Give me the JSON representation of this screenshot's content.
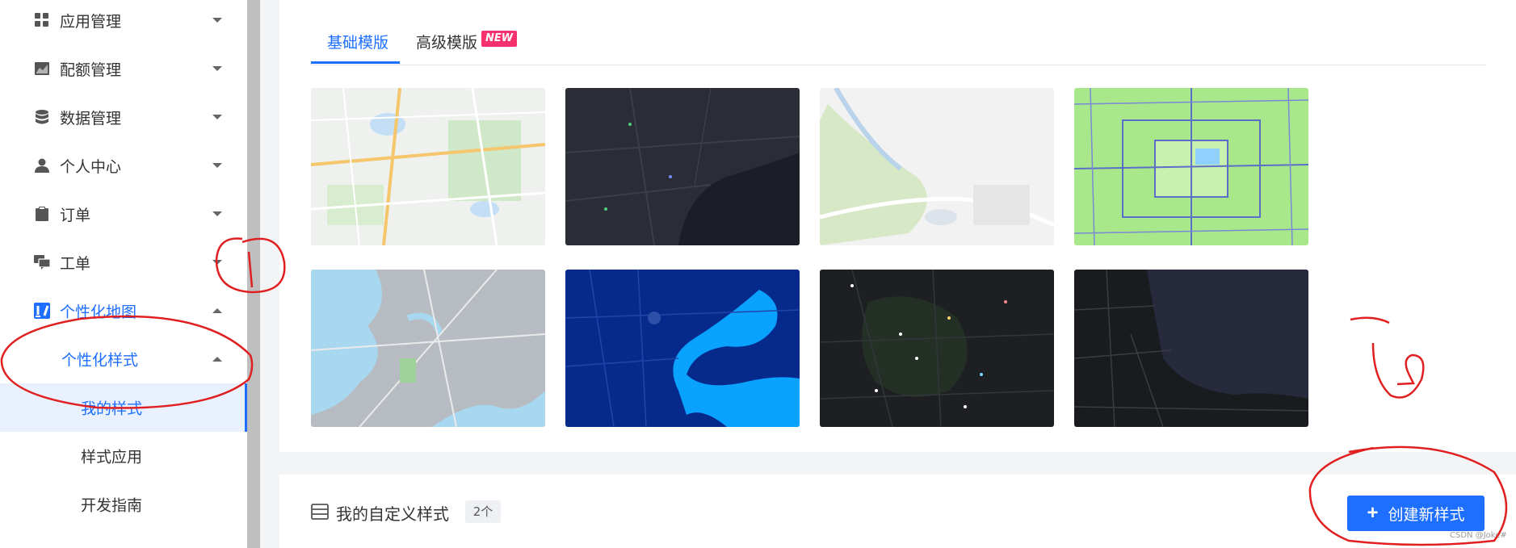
{
  "sidebar": {
    "items": [
      {
        "label": "应用管理",
        "icon": "grid-icon",
        "expanded": false
      },
      {
        "label": "配额管理",
        "icon": "chart-area-icon",
        "expanded": false
      },
      {
        "label": "数据管理",
        "icon": "database-icon",
        "expanded": false
      },
      {
        "label": "个人中心",
        "icon": "user-icon",
        "expanded": false
      },
      {
        "label": "订单",
        "icon": "clipboard-icon",
        "expanded": false
      },
      {
        "label": "工单",
        "icon": "chat-icon",
        "expanded": false
      },
      {
        "label": "个性化地图",
        "icon": "map-style-icon",
        "expanded": true
      }
    ],
    "submenu": {
      "label": "个性化样式",
      "children": [
        "我的样式",
        "样式应用",
        "开发指南"
      ]
    },
    "accent_color": "#1e6fff"
  },
  "tabs": [
    {
      "label": "基础模版",
      "active": true
    },
    {
      "label": "高级模版",
      "active": false
    }
  ],
  "new_badge": "NEW",
  "templates": [
    {
      "name": "standard-light",
      "color": "#eef1ee"
    },
    {
      "name": "dark",
      "color": "#24272f"
    },
    {
      "name": "light-gray",
      "color": "#f2f2f2"
    },
    {
      "name": "fresh-green",
      "color": "#a8e88a"
    },
    {
      "name": "gray-lake",
      "color": "#b7bcc2"
    },
    {
      "name": "deep-blue",
      "color": "#062a8c"
    },
    {
      "name": "night-dots",
      "color": "#1d1f22"
    },
    {
      "name": "midnight",
      "color": "#262a3c"
    }
  ],
  "section": {
    "title": "我的自定义样式",
    "count": "2个",
    "create_button": "创建新样式"
  },
  "watermark": "CSDN @Joke#"
}
